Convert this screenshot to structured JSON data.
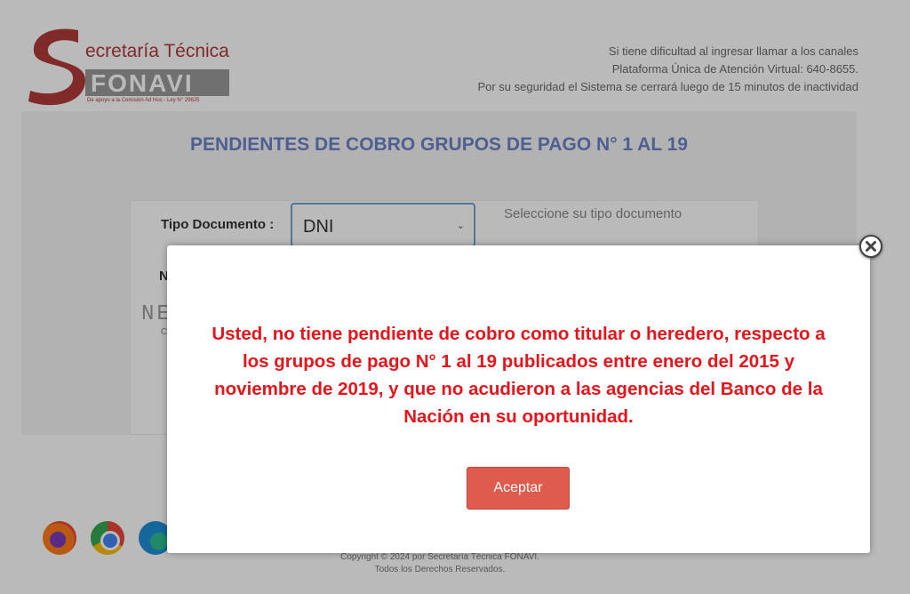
{
  "logo": {
    "line1": "ecretaría Técnica",
    "line2": "FONAVI",
    "tagline": "De apoyo a la Comisión Ad Hoc - Ley N° 29625"
  },
  "header": {
    "info_lines": [
      "Si tiene dificultad al ingresar llamar a los canales",
      "Plataforma Única de Atención Virtual: 640-8655.",
      "Por su seguridad el Sistema se cerrará luego de 15 minutos de inactividad"
    ]
  },
  "main": {
    "title": "PENDIENTES DE COBRO GRUPOS DE PAGO N° 1 AL 19",
    "form": {
      "doc_type_label": "Tipo Documento :",
      "doc_type_value": "DNI",
      "doc_type_hint": "Seleccione su tipo documento",
      "number_label": "N",
      "captcha_text": "NE",
      "captcha_sub": "C"
    }
  },
  "footer": {
    "browsers": [
      "firefox-icon",
      "chrome-icon",
      "edge-icon"
    ],
    "copyright_line1": "Copyright © 2024 por Secretaría Técnica FONAVI.",
    "copyright_line2": "Todos los Derechos Reservados."
  },
  "modal": {
    "message": "Usted, no tiene pendiente de cobro como titular o heredero, respecto a los grupos de pago N° 1 al 19 publicados entre enero del 2015 y noviembre de 2019, y que no acudieron a las agencias del Banco de la Nación en su oportunidad.",
    "accept_label": "Aceptar",
    "close_icon": "close-icon"
  },
  "colors": {
    "title_blue": "#6b84c8",
    "message_red": "#e8141b",
    "button_red": "#df5b4d",
    "logo_red": "#b03a3a"
  }
}
